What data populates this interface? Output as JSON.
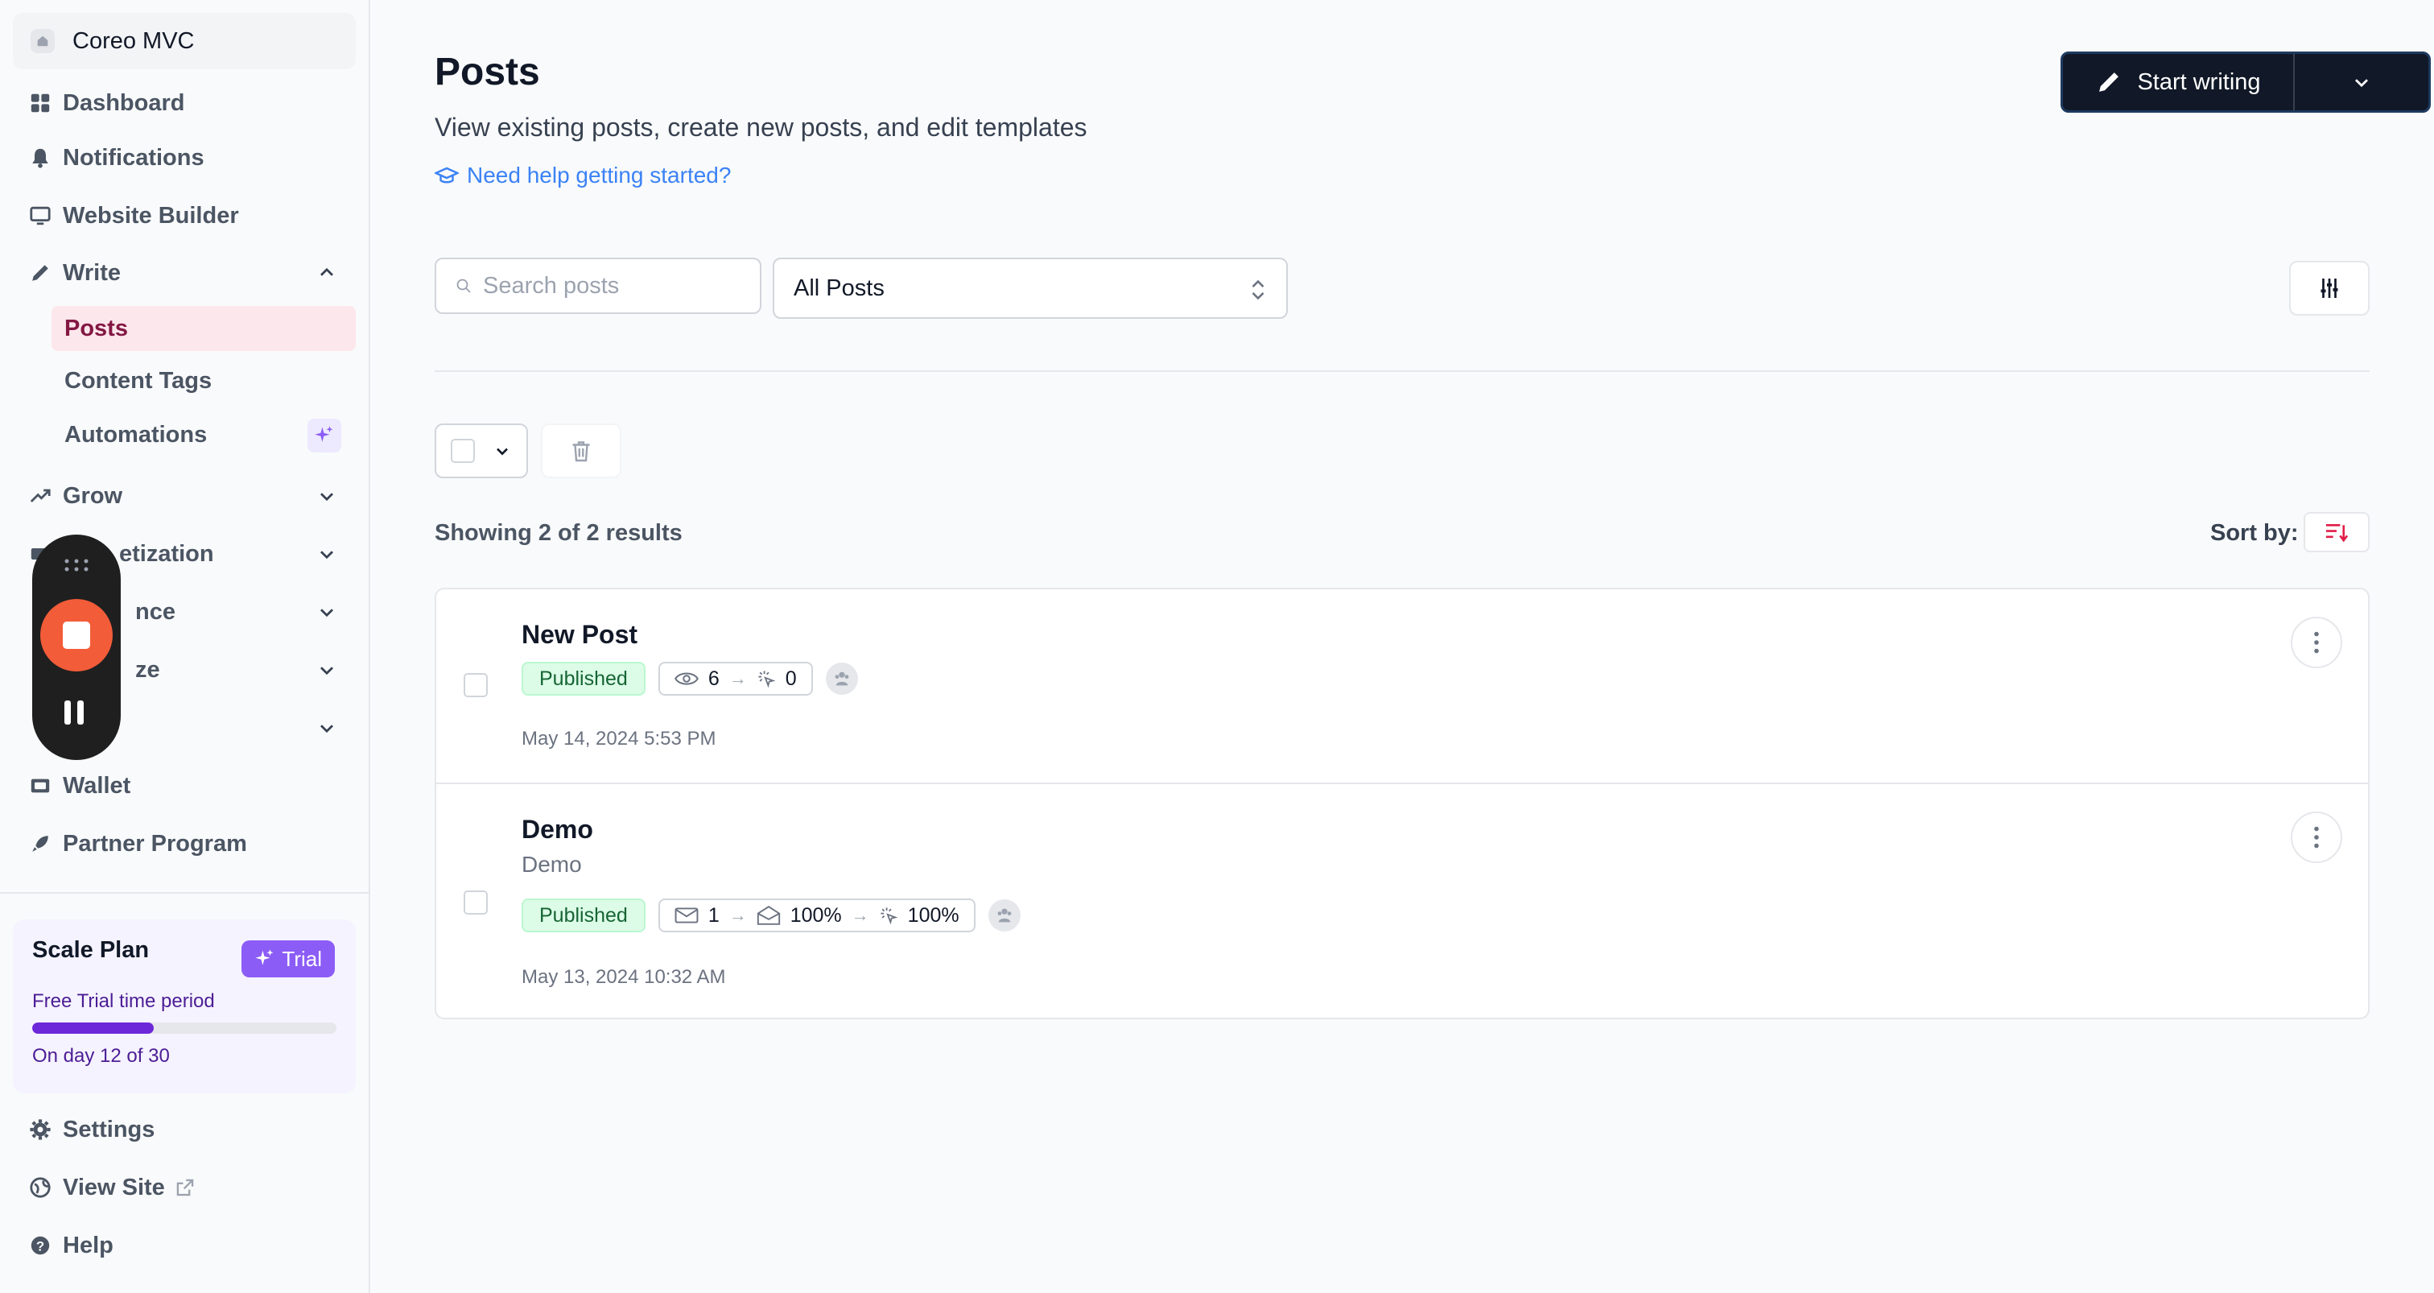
{
  "workspace": {
    "name": "Coreo MVC"
  },
  "sidebar": {
    "items": [
      {
        "label": "Dashboard"
      },
      {
        "label": "Notifications"
      },
      {
        "label": "Website Builder"
      },
      {
        "label": "Write"
      },
      {
        "label": "Grow"
      },
      {
        "label": "Monetization",
        "visible_text": "etization"
      },
      {
        "label": "Audience",
        "visible_text": "nce"
      },
      {
        "label": "Analyze",
        "visible_text": "ze"
      },
      {
        "label": ""
      },
      {
        "label": "Wallet"
      },
      {
        "label": "Partner Program"
      }
    ],
    "write_sub": [
      {
        "label": "Posts",
        "active": true
      },
      {
        "label": "Content Tags"
      },
      {
        "label": "Automations"
      }
    ],
    "bottom": [
      {
        "label": "Settings"
      },
      {
        "label": "View Site"
      },
      {
        "label": "Help"
      }
    ]
  },
  "plan": {
    "name": "Scale Plan",
    "badge": "Trial",
    "period_label": "Free Trial time period",
    "progress": 0.4,
    "day_label": "On day 12 of 30"
  },
  "header": {
    "title": "Posts",
    "subtitle": "View existing posts, create new posts, and edit templates",
    "help_link": "Need help getting started?",
    "primary_button": "Start writing"
  },
  "filters": {
    "search_placeholder": "Search posts",
    "select_value": "All Posts"
  },
  "list": {
    "results_text": "Showing 2 of 2 results",
    "sort_label": "Sort by:",
    "posts": [
      {
        "title": "New Post",
        "subtitle": "",
        "status": "Published",
        "views": "6",
        "clicks": "0",
        "date": "May 14, 2024 5:53 PM"
      },
      {
        "title": "Demo",
        "subtitle": "Demo",
        "status": "Published",
        "emails": "1",
        "open_rate": "100%",
        "click_rate": "100%",
        "date": "May 13, 2024 10:32 AM"
      }
    ]
  },
  "colors": {
    "accent": "#111827",
    "link": "#3b82f6",
    "active_nav_bg": "#fce7ec",
    "active_nav_text": "#831843",
    "trial": "#8b5cf6",
    "published_bg": "#dcfce7",
    "recorder_stop": "#f25c39"
  }
}
